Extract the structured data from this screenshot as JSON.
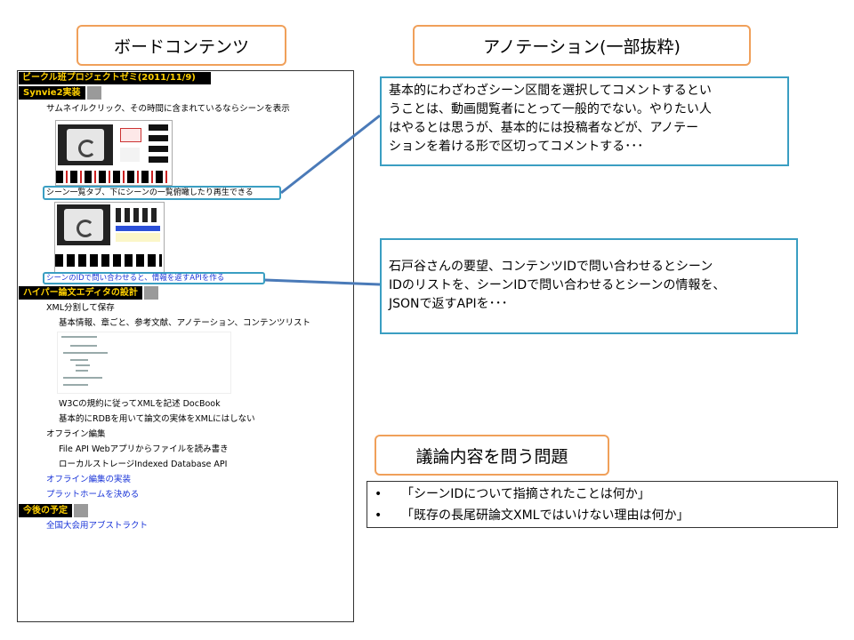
{
  "titles": {
    "board": "ボードコンテンツ",
    "annotation": "アノテーション(一部抜粋)",
    "discussion": "議論内容を問う問題"
  },
  "board": {
    "header": "ビークル班プロジェクトゼミ(2011/11/9)",
    "section1": "Synvie2実装",
    "line1": "サムネイルクリック、その時間に含まれているならシーンを表示",
    "highlight1": "シーン一覧タブ、下にシーンの一覧俯瞰したり再生できる",
    "highlight2": "シーンのIDで問い合わせると、情報を返すAPIを作る",
    "section2": "ハイパー論文エディタの設計",
    "xml_save": "XML分割して保存",
    "xml_items": "基本情報、章ごと、参考文献、アノテーション、コンテンツリスト",
    "w3c": "W3Cの規約に従ってXMLを記述 DocBook",
    "rdb": "基本的にRDBを用いて論文の実体をXMLにはしない",
    "offline": "オフライン編集",
    "fileapi": "File API Webアプリからファイルを読み書き",
    "localstorage": "ローカルストレージIndexed Database API",
    "offline_impl": "オフライン編集の実装",
    "platform": "プラットホームを決める",
    "section3": "今後の予定",
    "abstract": "全国大会用アブストラクト"
  },
  "annotations": {
    "a1_l1": "基本的にわざわざシーン区間を選択してコメントするとい",
    "a1_l2": "うことは、動画閲覧者にとって一般的でない。やりたい人",
    "a1_l3": "はやるとは思うが、基本的には投稿者などが、アノテー",
    "a1_l4": "ションを着ける形で区切ってコメントする･･･",
    "a2_l1": "石戸谷さんの要望、コンテンツIDで問い合わせるとシーン",
    "a2_l2": "IDのリストを、シーンIDで問い合わせるとシーンの情報を、",
    "a2_l3": "JSONで返すAPIを･･･"
  },
  "questions": {
    "bullet": "•",
    "q1": "「シーンIDについて指摘されたことは何か」",
    "q2": "「既存の長尾研論文XMLではいけない理由は何か」"
  },
  "colors": {
    "title_border": "#f0a05a",
    "anno_border": "#3a9ec2",
    "connector": "#4a7ab8",
    "header_bg": "#000000",
    "header_text": "#ffd000",
    "link_blue": "#1a35d8"
  }
}
